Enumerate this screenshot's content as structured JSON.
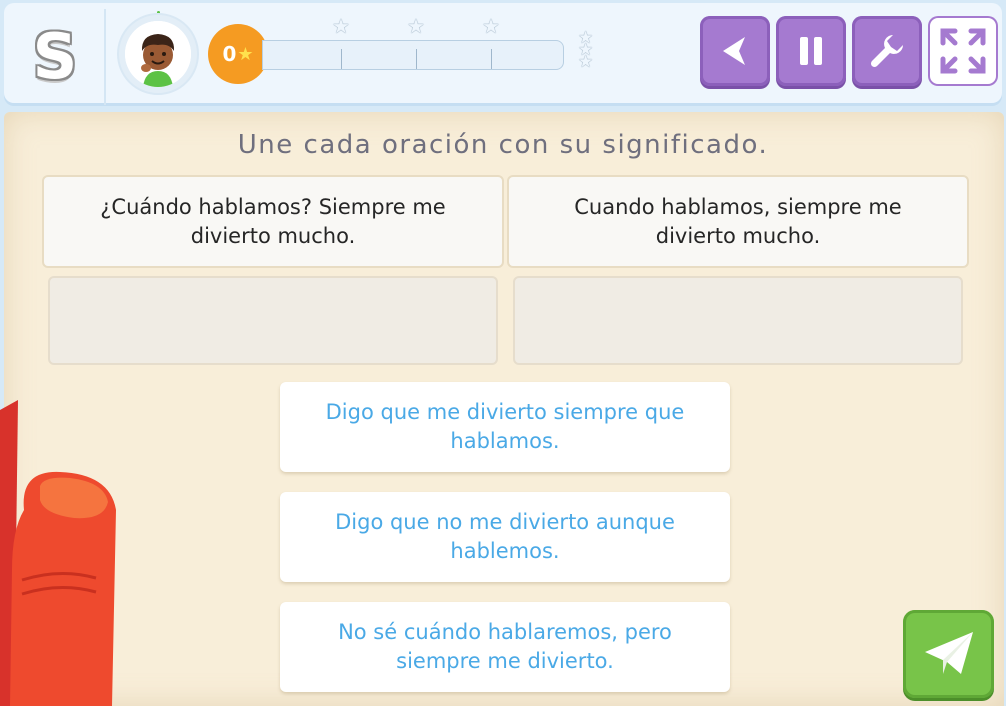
{
  "header": {
    "logo_letter": "S",
    "coins": "0",
    "progress_stars": 3,
    "buttons": [
      {
        "name": "back",
        "icon": "back-arrow-icon"
      },
      {
        "name": "pause",
        "icon": "pause-icon"
      },
      {
        "name": "settings",
        "icon": "wrench-icon"
      },
      {
        "name": "fullscreen",
        "icon": "fullscreen-icon"
      }
    ]
  },
  "exercise": {
    "instruction": "Une cada oración con su significado.",
    "targets": [
      {
        "text": "¿Cuándo hablamos? Siempre me divierto mucho."
      },
      {
        "text": "Cuando hablamos, siempre me divierto mucho."
      }
    ],
    "options": [
      {
        "text": "Digo que me divierto siempre que hablamos."
      },
      {
        "text": "Digo que no me divierto aunque hablemos."
      },
      {
        "text": "No sé cuándo hablaremos, pero siempre me divierto."
      }
    ]
  },
  "colors": {
    "accent_purple": "#a57ad0",
    "send_green": "#78c449",
    "option_text": "#4aa9e6",
    "coin_orange": "#f59b22"
  }
}
